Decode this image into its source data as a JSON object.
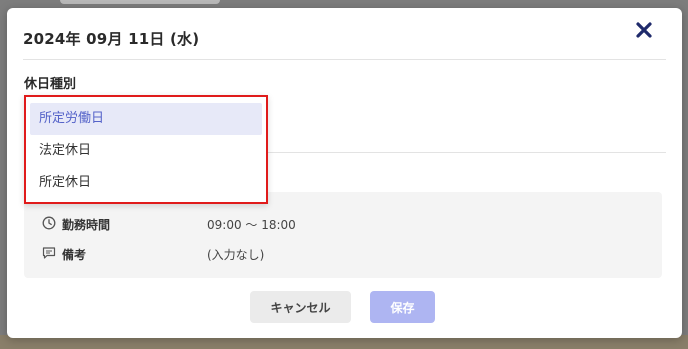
{
  "modal": {
    "title": "2024年 09月 11日 (水)"
  },
  "holiday_type": {
    "label": "休日種別",
    "options": [
      {
        "label": "所定労働日",
        "selected": true
      },
      {
        "label": "法定休日",
        "selected": false
      },
      {
        "label": "所定休日",
        "selected": false
      }
    ]
  },
  "info": {
    "work_hours": {
      "label": "勤務時間",
      "value": "09:00 〜 18:00",
      "icon": "clock-icon"
    },
    "note": {
      "label": "備考",
      "value": "(入力なし)",
      "icon": "comment-icon"
    }
  },
  "footer": {
    "cancel_label": "キャンセル",
    "save_label": "保存"
  },
  "colors": {
    "accent": "#5563c9",
    "close_icon": "#1f2a6b",
    "highlight_border": "#e01b1b",
    "save_disabled": "#aeb5f2"
  }
}
